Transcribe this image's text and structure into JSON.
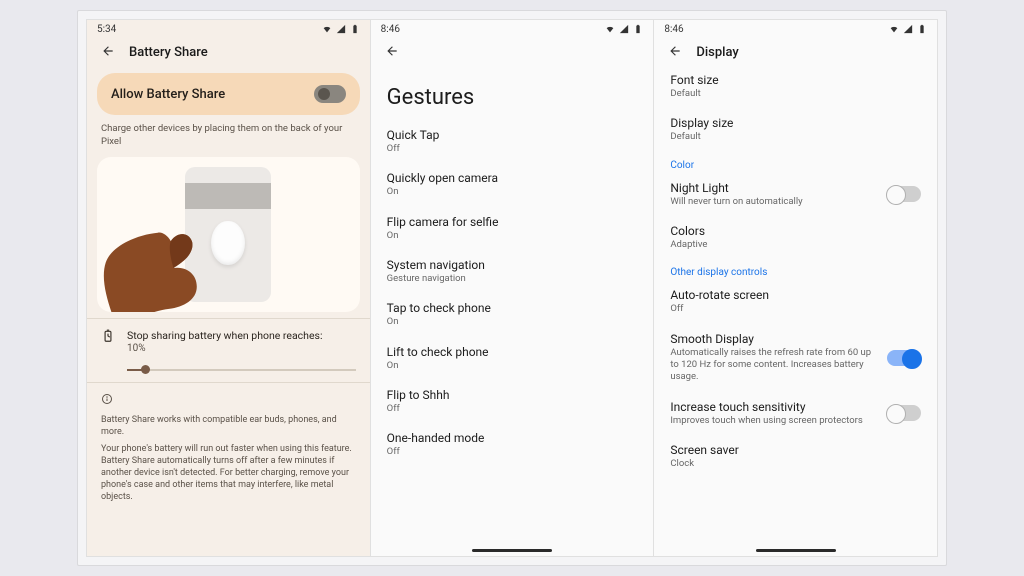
{
  "screen1": {
    "time": "5:34",
    "title": "Battery Share",
    "allow_label": "Allow Battery Share",
    "desc": "Charge other devices by placing them on the back of your Pixel",
    "slider_label": "Stop sharing battery when phone reaches:",
    "slider_value": "10%",
    "info1": "Battery Share works with compatible ear buds, phones, and more.",
    "info2": "Your phone's battery will run out faster when using this feature. Battery Share automatically turns off after a few minutes if another device isn't detected. For better charging, remove your phone's case and other items that may interfere, like metal objects."
  },
  "screen2": {
    "time": "8:46",
    "title": "Gestures",
    "items": [
      {
        "label": "Quick Tap",
        "sub": "Off"
      },
      {
        "label": "Quickly open camera",
        "sub": "On"
      },
      {
        "label": "Flip camera for selfie",
        "sub": "On"
      },
      {
        "label": "System navigation",
        "sub": "Gesture navigation"
      },
      {
        "label": "Tap to check phone",
        "sub": "On"
      },
      {
        "label": "Lift to check phone",
        "sub": "On"
      },
      {
        "label": "Flip to Shhh",
        "sub": "Off"
      },
      {
        "label": "One-handed mode",
        "sub": "Off"
      }
    ]
  },
  "screen3": {
    "time": "8:46",
    "title": "Display",
    "font_size": {
      "label": "Font size",
      "sub": "Default"
    },
    "display_size": {
      "label": "Display size",
      "sub": "Default"
    },
    "sec_color": "Color",
    "night_light": {
      "label": "Night Light",
      "sub": "Will never turn on automatically",
      "on": false
    },
    "colors": {
      "label": "Colors",
      "sub": "Adaptive"
    },
    "sec_other": "Other display controls",
    "autorotate": {
      "label": "Auto-rotate screen",
      "sub": "Off"
    },
    "smooth": {
      "label": "Smooth Display",
      "sub": "Automatically raises the refresh rate from 60 up to 120 Hz for some content. Increases battery usage.",
      "on": true
    },
    "touch": {
      "label": "Increase touch sensitivity",
      "sub": "Improves touch when using screen protectors",
      "on": false
    },
    "saver": {
      "label": "Screen saver",
      "sub": "Clock"
    }
  }
}
